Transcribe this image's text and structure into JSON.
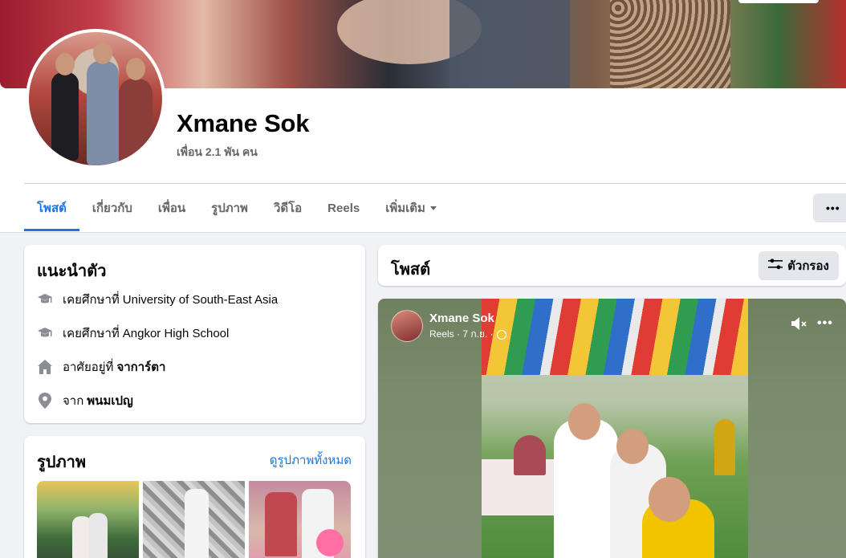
{
  "profile": {
    "name": "Xmane Sok",
    "friends": "เพื่อน 2.1 พัน คน"
  },
  "tabs": [
    {
      "label": "โพสต์"
    },
    {
      "label": "เกี่ยวกับ"
    },
    {
      "label": "เพื่อน"
    },
    {
      "label": "รูปภาพ"
    },
    {
      "label": "วิดีโอ"
    },
    {
      "label": "Reels"
    },
    {
      "label": "เพิ่มเติม"
    }
  ],
  "more_button": "•••",
  "intro": {
    "title": "แนะนำตัว",
    "items": [
      {
        "icon": "graduation-cap-icon",
        "prefix": "เคยศึกษาที่",
        "value": "University of South-East Asia"
      },
      {
        "icon": "graduation-cap-icon",
        "prefix": "เคยศึกษาที่",
        "value": "Angkor High School"
      },
      {
        "icon": "home-icon",
        "prefix": "อาศัยอยู่ที่",
        "value": "จาการ์ตา"
      },
      {
        "icon": "location-pin-icon",
        "prefix": "จาก",
        "value": "พนมเปญ"
      }
    ]
  },
  "photos": {
    "title": "รูปภาพ",
    "see_all": "ดูรูปภาพทั้งหมด"
  },
  "posts": {
    "title": "โพสต์",
    "filter_label": "ตัวกรอง"
  },
  "reel_post": {
    "author": "Xmane Sok",
    "meta": "Reels · 7 ก.ย. ·",
    "more": "•••"
  },
  "colors": {
    "accent": "#1b74e4",
    "secondary_text": "#65676b",
    "background": "#f0f2f5"
  }
}
